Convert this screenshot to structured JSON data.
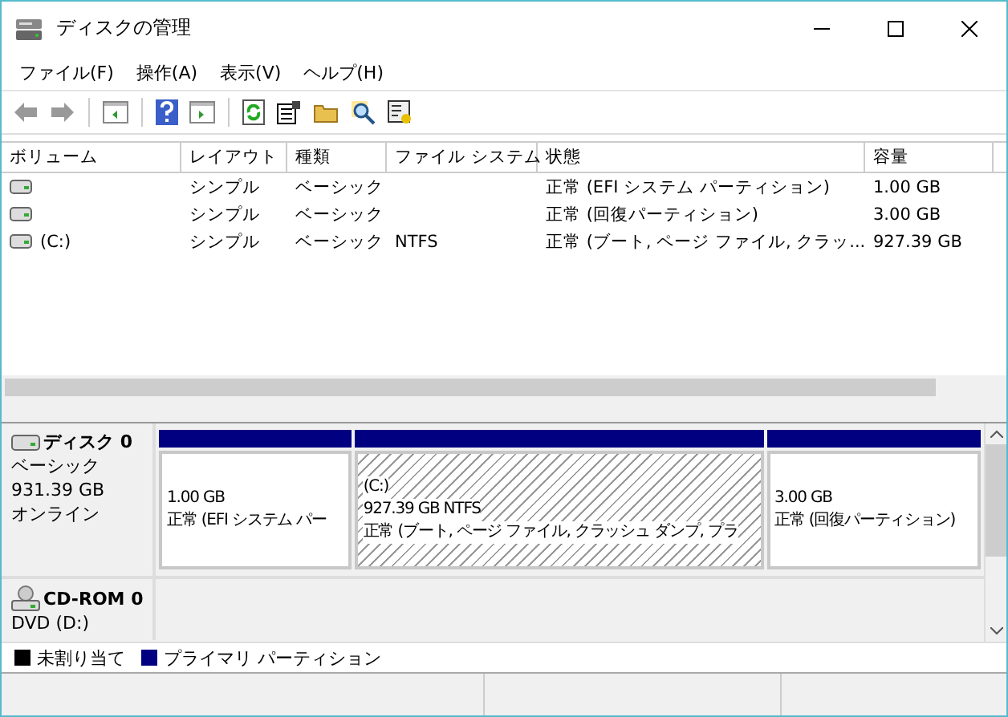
{
  "window": {
    "title": "ディスクの管理"
  },
  "menu": [
    {
      "label": "ファイル(F)"
    },
    {
      "label": "操作(A)"
    },
    {
      "label": "表示(V)"
    },
    {
      "label": "ヘルプ(H)"
    }
  ],
  "table": {
    "columns": [
      "ボリューム",
      "レイアウト",
      "種類",
      "ファイル システム",
      "状態",
      "容量"
    ],
    "rows": [
      {
        "layout": "シンプル",
        "type": "ベーシック",
        "status": "正常 (EFI システム パーティション)",
        "capacity": "1.00 GB"
      },
      {
        "layout": "シンプル",
        "type": "ベーシック",
        "status": "正常 (回復パーティション)",
        "capacity": "3.00 GB"
      },
      {
        "volume": "(C:)",
        "layout": "シンプル",
        "type": "ベーシック",
        "fs": "NTFS",
        "status": "正常 (ブート, ページ ファイル, クラッ...",
        "capacity": "927.39 GB"
      }
    ]
  },
  "disks": [
    {
      "kind": "disk",
      "name": "ディスク 0",
      "lines": [
        "ベーシック",
        "931.39 GB",
        "オンライン"
      ],
      "partitions": [
        {
          "size": "1.00 GB",
          "status": "正常 (EFI システム パー",
          "selected": false
        },
        {
          "label": "(C:)",
          "size": "927.39 GB NTFS",
          "status": "正常 (ブート, ページ ファイル, クラッシュ ダンプ, プラ",
          "selected": true
        },
        {
          "size": "3.00 GB",
          "status": "正常 (回復パーティション)",
          "selected": false
        }
      ]
    },
    {
      "kind": "cdrom",
      "name": "CD-ROM 0",
      "lines": [
        "DVD (D:)"
      ]
    }
  ],
  "legend": [
    {
      "label": "未割り当て",
      "color": "#000000"
    },
    {
      "label": "プライマリ パーティション",
      "color": "#000080"
    }
  ]
}
